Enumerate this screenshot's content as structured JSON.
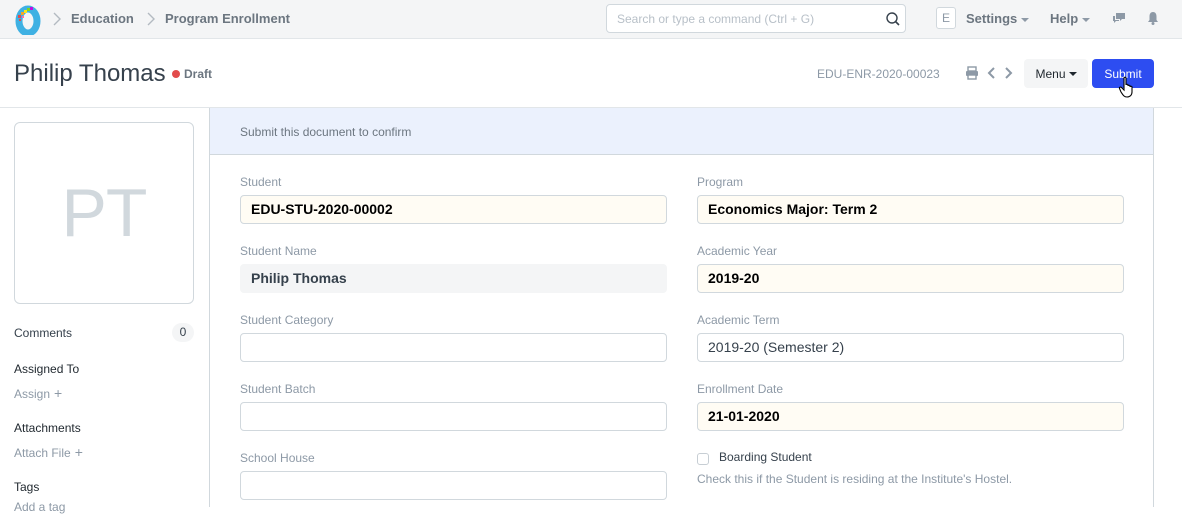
{
  "navbar": {
    "breadcrumbs": [
      {
        "label": "Education"
      },
      {
        "label": "Program Enrollment"
      }
    ],
    "search": {
      "placeholder": "Search or type a command (Ctrl + G)",
      "value": ""
    },
    "user_initial": "E",
    "settings_label": "Settings",
    "help_label": "Help",
    "icons": [
      "chat-icon",
      "bell-icon"
    ]
  },
  "page_head": {
    "title": "Philip Thomas",
    "status": "Draft",
    "status_color": "#e24c4c",
    "doc_id": "EDU-ENR-2020-00023",
    "menu_label": "Menu",
    "submit_label": "Submit",
    "accent_color": "#2d4df1"
  },
  "sidebar": {
    "initials": "PT",
    "comments_label": "Comments",
    "comments_count": "0",
    "assigned_to_label": "Assigned To",
    "assign_link": "Assign",
    "attachments_label": "Attachments",
    "attach_link": "Attach File",
    "tags_label": "Tags",
    "add_tag_link": "Add a tag"
  },
  "form": {
    "message": "Submit this document to confirm",
    "fields": {
      "student": {
        "label": "Student",
        "value": "EDU-STU-2020-00002"
      },
      "student_name": {
        "label": "Student Name",
        "value": "Philip Thomas"
      },
      "student_category": {
        "label": "Student Category",
        "value": ""
      },
      "student_batch": {
        "label": "Student Batch",
        "value": ""
      },
      "school_house": {
        "label": "School House",
        "value": ""
      },
      "program": {
        "label": "Program",
        "value": "Economics Major: Term 2"
      },
      "academic_year": {
        "label": "Academic Year",
        "value": "2019-20"
      },
      "academic_term": {
        "label": "Academic Term",
        "value": "2019-20 (Semester 2)"
      },
      "enrollment_date": {
        "label": "Enrollment Date",
        "value": "21-01-2020"
      }
    },
    "boarding_student": {
      "label": "Boarding Student",
      "checked": false,
      "help": "Check this if the Student is residing at the Institute's Hostel."
    }
  }
}
